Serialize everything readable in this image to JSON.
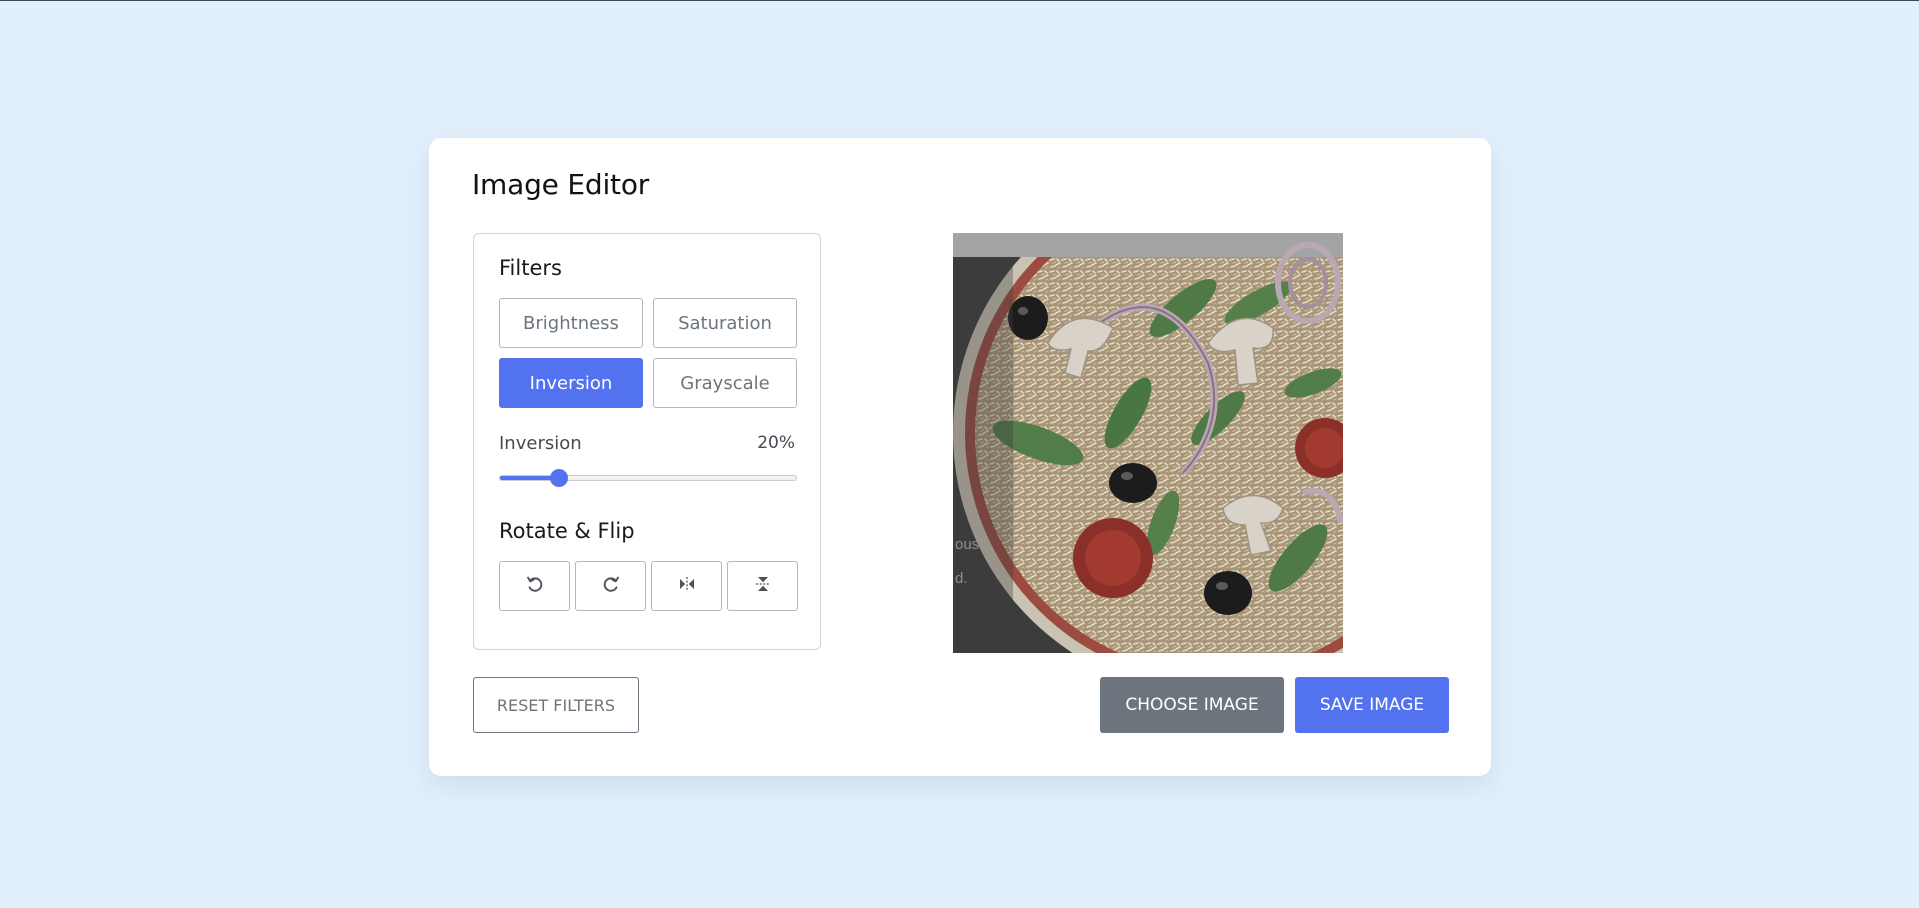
{
  "app": {
    "title": "Image Editor"
  },
  "filters": {
    "heading": "Filters",
    "buttons": [
      {
        "label": "Brightness",
        "active": false
      },
      {
        "label": "Saturation",
        "active": false
      },
      {
        "label": "Inversion",
        "active": true
      },
      {
        "label": "Grayscale",
        "active": false
      }
    ],
    "slider": {
      "name": "Inversion",
      "value_text": "20%",
      "value": 20,
      "min": 0,
      "max": 100
    }
  },
  "rotate_flip": {
    "heading": "Rotate & Flip",
    "icons": [
      "rotate-left-icon",
      "rotate-right-icon",
      "flip-horizontal-icon",
      "flip-vertical-icon"
    ]
  },
  "preview": {
    "overlay_text": [
      "ous",
      "d."
    ]
  },
  "controls": {
    "reset_label": "RESET FILTERS",
    "choose_label": "CHOOSE IMAGE",
    "save_label": "SAVE IMAGE"
  },
  "colors": {
    "page_bg": "#e2f0fc",
    "accent": "#5372f0",
    "secondary": "#6c757d"
  }
}
